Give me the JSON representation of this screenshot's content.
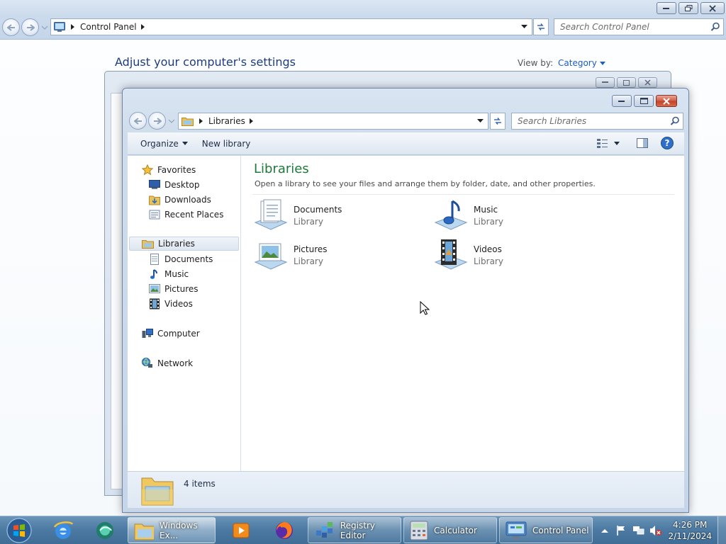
{
  "control_panel": {
    "address": [
      "Control Panel"
    ],
    "search_placeholder": "Search Control Panel",
    "heading": "Adjust your computer's settings",
    "view_by_label": "View by:",
    "view_by_value": "Category"
  },
  "libraries_window": {
    "address": [
      "Libraries"
    ],
    "search_placeholder": "Search Libraries",
    "toolbar": {
      "organize": "Organize",
      "new_library": "New library"
    },
    "nav": {
      "favorites": "Favorites",
      "favorites_items": [
        "Desktop",
        "Downloads",
        "Recent Places"
      ],
      "libraries": "Libraries",
      "libraries_items": [
        "Documents",
        "Music",
        "Pictures",
        "Videos"
      ],
      "computer": "Computer",
      "network": "Network"
    },
    "main": {
      "title": "Libraries",
      "subtitle": "Open a library to see your files and arrange them by folder, date, and other properties.",
      "items": [
        {
          "name": "Documents",
          "type": "Library"
        },
        {
          "name": "Music",
          "type": "Library"
        },
        {
          "name": "Pictures",
          "type": "Library"
        },
        {
          "name": "Videos",
          "type": "Library"
        }
      ]
    },
    "details": {
      "count": "4 items"
    }
  },
  "taskbar": {
    "buttons": [
      {
        "label": "Windows Ex..."
      },
      {
        "label": "Registry Editor"
      },
      {
        "label": "Calculator"
      },
      {
        "label": "Control Panel"
      }
    ],
    "clock_time": "4:26 PM",
    "clock_date": "2/11/2024"
  },
  "colors": {
    "title_green": "#1e7a3a",
    "link_blue": "#1e5ebf",
    "taskbar": "#4d7ba3"
  }
}
